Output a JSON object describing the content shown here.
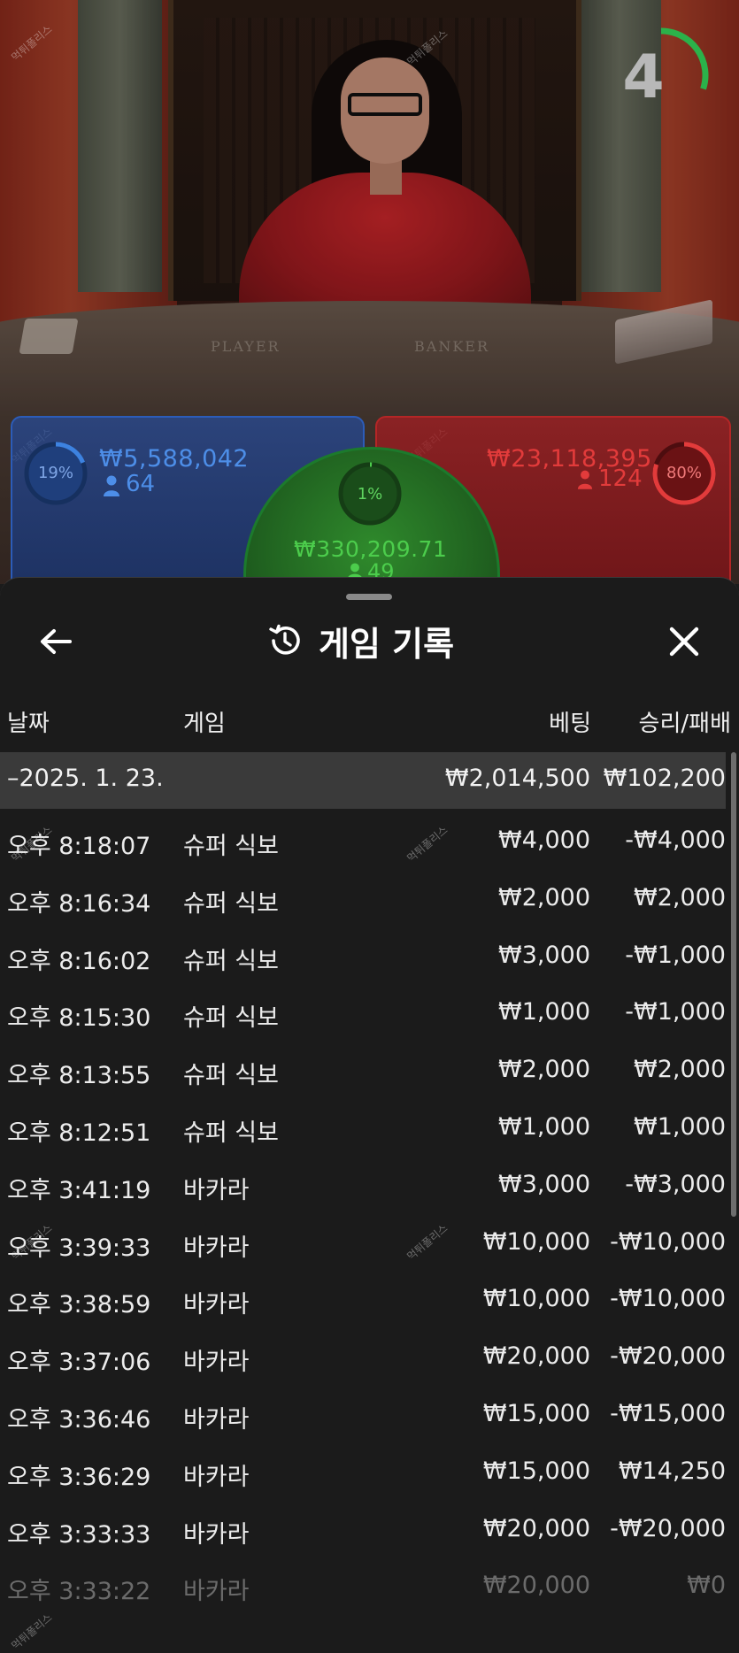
{
  "game_view": {
    "table_labels": {
      "player": "PLAYER",
      "banker": "BANKER"
    },
    "timer": {
      "value": "4",
      "remaining_fraction": 0.3,
      "ring_color": "#2bb24a"
    },
    "watermark": "먹튀폴리스",
    "player": {
      "percent": "19%",
      "amount": "₩5,588,042",
      "players": "64",
      "color": "#3d82e0"
    },
    "tie": {
      "percent": "1%",
      "amount": "₩330,209.71",
      "players": "49",
      "color": "#4ccd4c"
    },
    "banker": {
      "percent": "80%",
      "amount": "₩23,118,395",
      "players": "124",
      "color": "#e23b3b"
    }
  },
  "sheet": {
    "title": "게임 기록",
    "icons": {
      "back": "arrow-left-icon",
      "history": "history-icon",
      "close": "close-icon"
    },
    "columns": {
      "date": "날짜",
      "game": "게임",
      "bet": "베팅",
      "win_loss": "승리/패배"
    },
    "date_group": {
      "date": "–2025. 1. 23.",
      "bet_total": "₩2,014,500",
      "win_loss_total": "₩102,200"
    },
    "rows": [
      {
        "time": "오후 8:18:07",
        "game": "슈퍼 식보",
        "bet": "₩4,000",
        "win_loss": "-₩4,000"
      },
      {
        "time": "오후 8:16:34",
        "game": "슈퍼 식보",
        "bet": "₩2,000",
        "win_loss": "₩2,000"
      },
      {
        "time": "오후 8:16:02",
        "game": "슈퍼 식보",
        "bet": "₩3,000",
        "win_loss": "-₩1,000"
      },
      {
        "time": "오후 8:15:30",
        "game": "슈퍼 식보",
        "bet": "₩1,000",
        "win_loss": "-₩1,000"
      },
      {
        "time": "오후 8:13:55",
        "game": "슈퍼 식보",
        "bet": "₩2,000",
        "win_loss": "₩2,000"
      },
      {
        "time": "오후 8:12:51",
        "game": "슈퍼 식보",
        "bet": "₩1,000",
        "win_loss": "₩1,000"
      },
      {
        "time": "오후 3:41:19",
        "game": "바카라",
        "bet": "₩3,000",
        "win_loss": "-₩3,000"
      },
      {
        "time": "오후 3:39:33",
        "game": "바카라",
        "bet": "₩10,000",
        "win_loss": "-₩10,000"
      },
      {
        "time": "오후 3:38:59",
        "game": "바카라",
        "bet": "₩10,000",
        "win_loss": "-₩10,000"
      },
      {
        "time": "오후 3:37:06",
        "game": "바카라",
        "bet": "₩20,000",
        "win_loss": "-₩20,000"
      },
      {
        "time": "오후 3:36:46",
        "game": "바카라",
        "bet": "₩15,000",
        "win_loss": "-₩15,000"
      },
      {
        "time": "오후 3:36:29",
        "game": "바카라",
        "bet": "₩15,000",
        "win_loss": "₩14,250"
      },
      {
        "time": "오후 3:33:33",
        "game": "바카라",
        "bet": "₩20,000",
        "win_loss": "-₩20,000"
      },
      {
        "time": "오후 3:33:22",
        "game": "바카라",
        "bet": "₩20,000",
        "win_loss": "₩0"
      }
    ]
  }
}
